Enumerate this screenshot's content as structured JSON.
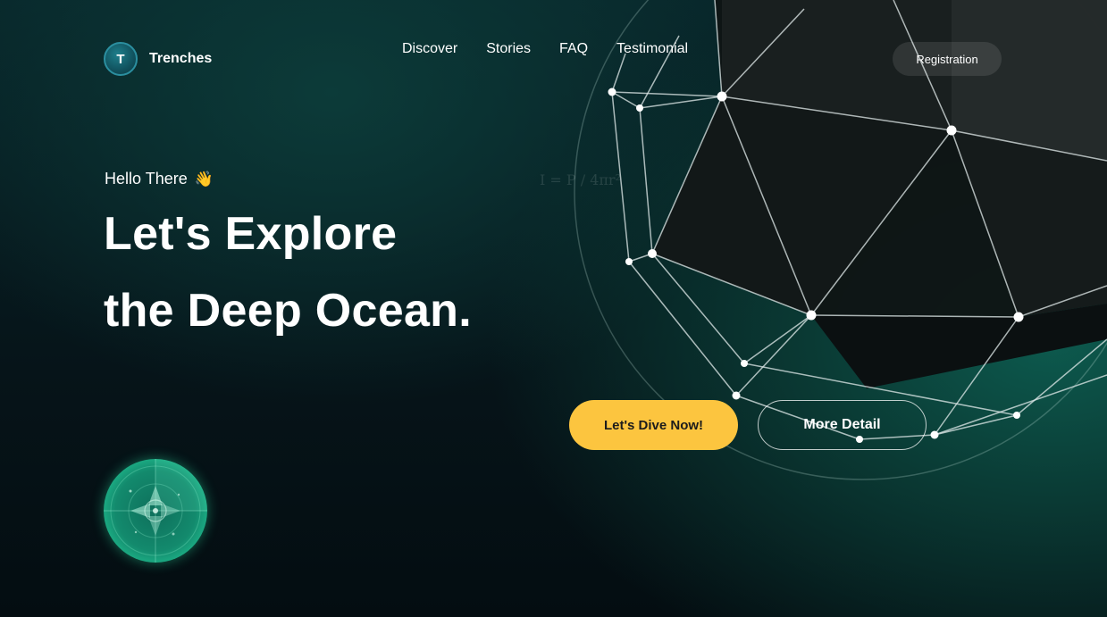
{
  "brand": {
    "initial": "T",
    "name": "Trenches"
  },
  "nav": {
    "items": [
      "Discover",
      "Stories",
      "FAQ",
      "Testimonial"
    ],
    "register_label": "Registration"
  },
  "hero": {
    "greeting": "Hello There",
    "greeting_icon": "waving-hand-icon",
    "headline_line1": "Let's Explore",
    "headline_line2": "the Deep Ocean.",
    "formula": "I = P / 4πr²",
    "primary_cta": "Let's Dive Now!",
    "secondary_cta": "More Detail"
  },
  "colors": {
    "accent": "#fcc53f",
    "background_dark": "#061419",
    "teal": "#0d5a4e",
    "radar_green": "#22c493"
  }
}
